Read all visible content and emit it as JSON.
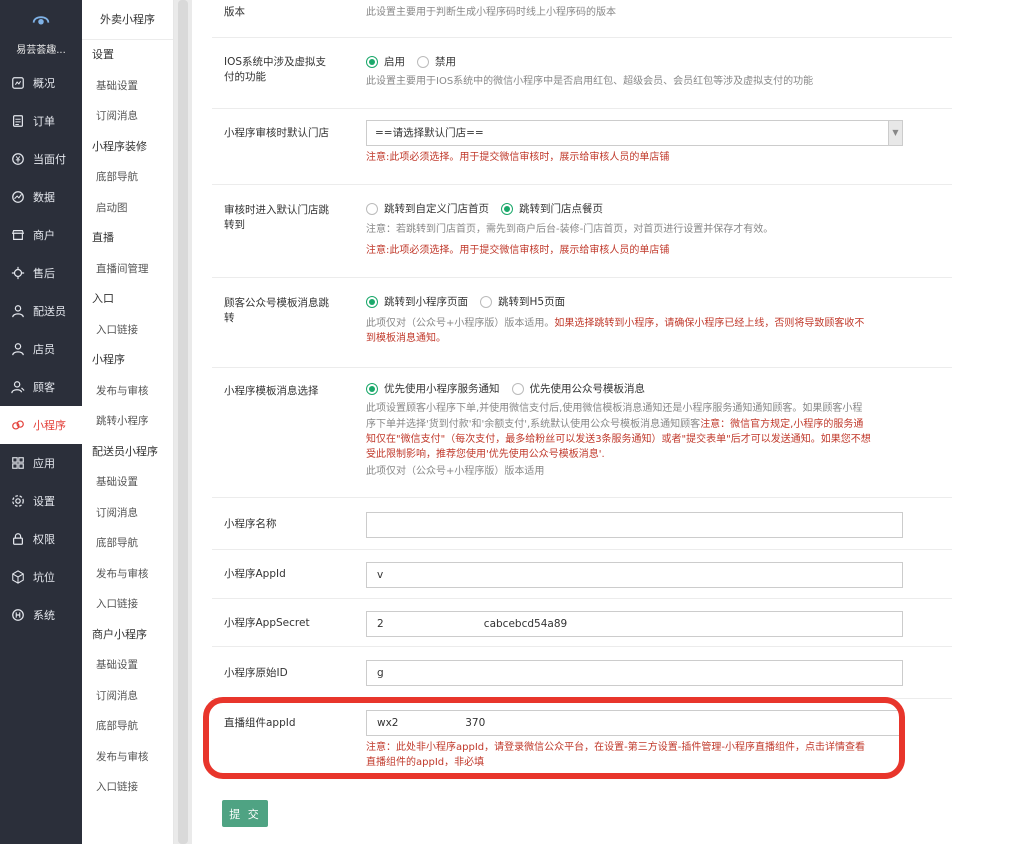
{
  "brand": "易芸荟趣...",
  "nav": [
    {
      "label": "概况",
      "icon": "overview-icon"
    },
    {
      "label": "订单",
      "icon": "order-icon"
    },
    {
      "label": "当面付",
      "icon": "pay-icon"
    },
    {
      "label": "数据",
      "icon": "data-icon"
    },
    {
      "label": "商户",
      "icon": "merchant-icon"
    },
    {
      "label": "售后",
      "icon": "aftersale-icon"
    },
    {
      "label": "配送员",
      "icon": "courier-icon"
    },
    {
      "label": "店员",
      "icon": "clerk-icon"
    },
    {
      "label": "顾客",
      "icon": "customer-icon"
    },
    {
      "label": "小程序",
      "icon": "miniprogram-icon",
      "active": true
    },
    {
      "label": "应用",
      "icon": "apps-icon"
    },
    {
      "label": "设置",
      "icon": "gear-icon"
    },
    {
      "label": "权限",
      "icon": "lock-icon"
    },
    {
      "label": "坑位",
      "icon": "cube-icon"
    },
    {
      "label": "系统",
      "icon": "system-icon"
    }
  ],
  "sub": {
    "title": "外卖小程序",
    "entries": [
      {
        "type": "grp",
        "label": "设置"
      },
      {
        "type": "lnk",
        "label": "基础设置"
      },
      {
        "type": "lnk",
        "label": "订阅消息"
      },
      {
        "type": "grp",
        "label": "小程序装修"
      },
      {
        "type": "lnk",
        "label": "底部导航"
      },
      {
        "type": "lnk",
        "label": "启动图"
      },
      {
        "type": "grp",
        "label": "直播"
      },
      {
        "type": "lnk",
        "label": "直播间管理"
      },
      {
        "type": "grp",
        "label": "入口"
      },
      {
        "type": "lnk",
        "label": "入口链接"
      },
      {
        "type": "grp",
        "label": "小程序"
      },
      {
        "type": "lnk",
        "label": "发布与审核"
      },
      {
        "type": "lnk",
        "label": "跳转小程序"
      },
      {
        "type": "grp",
        "label": "配送员小程序"
      },
      {
        "type": "lnk",
        "label": "基础设置"
      },
      {
        "type": "lnk",
        "label": "订阅消息"
      },
      {
        "type": "lnk",
        "label": "底部导航"
      },
      {
        "type": "lnk",
        "label": "发布与审核"
      },
      {
        "type": "lnk",
        "label": "入口链接"
      },
      {
        "type": "grp",
        "label": "商户小程序"
      },
      {
        "type": "lnk",
        "label": "基础设置"
      },
      {
        "type": "lnk",
        "label": "订阅消息"
      },
      {
        "type": "lnk",
        "label": "底部导航"
      },
      {
        "type": "lnk",
        "label": "发布与审核"
      },
      {
        "type": "lnk",
        "label": "入口链接"
      }
    ]
  },
  "form": {
    "version": {
      "label": "版本",
      "help": "此设置主要用于判断生成小程序码时线上小程序码的版本"
    },
    "ios_pay": {
      "label": "IOS系统中涉及虚拟支付的功能",
      "opt_on": "启用",
      "opt_off": "禁用",
      "help": "此设置主要用于IOS系统中的微信小程序中是否启用红包、超级会员、会员红包等涉及虚拟支付的功能"
    },
    "review_store": {
      "label": "小程序审核时默认门店",
      "select": "==请选择默认门店==",
      "warn": "注意:此项必须选择。用于提交微信审核时，展示给审核人员的单店铺"
    },
    "review_jump": {
      "label": "审核时进入默认门店跳转到",
      "opt1": "跳转到自定义门店首页",
      "opt2": "跳转到门店点餐页",
      "help": "注意：若跳转到门店首页，需先到商户后台-装修-门店首页，对首页进行设置并保存才有效。",
      "warn": "注意:此项必须选择。用于提交微信审核时，展示给审核人员的单店铺"
    },
    "tmpl_jump": {
      "label": "顾客公众号模板消息跳转",
      "opt1": "跳转到小程序页面",
      "opt2": "跳转到H5页面",
      "help": "此项仅对（公众号+小程序版）版本适用。",
      "warn1": "如果选择跳转到小程序，请确保小程序已经上线，否则将导致顾客收不",
      "warn2": "到模板消息通知。"
    },
    "tmpl_select": {
      "label": "小程序模板消息选择",
      "opt1": "优先使用小程序服务通知",
      "opt2": "优先使用公众号模板消息",
      "help1": "此项设置顾客小程序下单,并使用微信支付后,使用微信模板消息通知还是小程序服务通知通知顾客。如果顾客小程",
      "help2": "序下单并选择'货到付款'和'余额支付',系统默认使用公众号模板消息通知顾客",
      "warn2": "注意：微信官方规定,小程序的服务通",
      "warn3": "知仅在\"微信支付\"（每次支付，最多给粉丝可以发送3条服务通知）或者\"提交表单\"后才可以发送通知。如果您不想",
      "warn4": "受此限制影响，推荐您使用'优先使用公众号模板消息'.",
      "help5": "此项仅对（公众号+小程序版）版本适用"
    },
    "app_name": {
      "label": "小程序名称",
      "value": ""
    },
    "app_id": {
      "label": "小程序AppId",
      "value": "v"
    },
    "app_secret": {
      "label": "小程序AppSecret",
      "value": "2                              cabcebcd54a89"
    },
    "orig_id": {
      "label": "小程序原始ID",
      "value": "g"
    },
    "live_appid": {
      "label": "直播组件appId",
      "value": "wx2                    370",
      "warn1": "注意：此处非小程序appId，请登录微信公众平台，在设置-第三方设置-插件管理-小程序直播组件，点击详情查看",
      "warn2": "直播组件的appId，非必填"
    },
    "submit": "提 交"
  },
  "colors": {
    "nav_bg": "#2b2f3a",
    "accent_red": "#e3403a",
    "radio_green": "#1aa86a",
    "submit_bg": "#4fa383",
    "highlight": "#e8352b"
  }
}
